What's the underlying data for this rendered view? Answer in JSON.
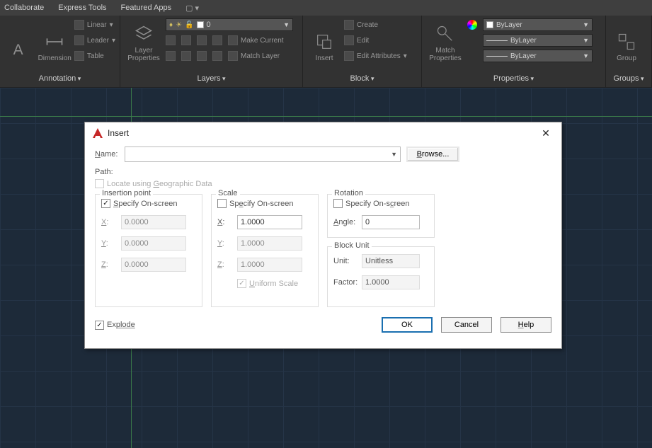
{
  "menu": {
    "collaborate": "Collaborate",
    "express": "Express Tools",
    "featured": "Featured Apps"
  },
  "ribbon": {
    "annotation": {
      "footer": "Annotation",
      "dimension": "Dimension",
      "linear": "Linear",
      "leader": "Leader",
      "table": "Table"
    },
    "layers": {
      "footer": "Layers",
      "properties": "Layer\nProperties",
      "current": "0",
      "make_current": "Make Current",
      "match": "Match Layer"
    },
    "block": {
      "footer": "Block",
      "insert": "Insert",
      "create": "Create",
      "edit": "Edit",
      "editattr": "Edit Attributes"
    },
    "properties": {
      "footer": "Properties",
      "match": "Match\nProperties",
      "color": "ByLayer",
      "ltype": "ByLayer",
      "lweight": "ByLayer"
    },
    "group": {
      "footer": "Groups",
      "group": "Group"
    }
  },
  "dialog": {
    "title": "Insert",
    "name_label": "Name:",
    "name_value": "",
    "browse": "Browse...",
    "path_label": "Path:",
    "locate_geo": "Locate using Geographic Data",
    "specify": "Specify On-screen",
    "insertion": {
      "title": "Insertion point",
      "x": "0.0000",
      "y": "0.0000",
      "z": "0.0000"
    },
    "scale": {
      "title": "Scale",
      "x": "1.0000",
      "y": "1.0000",
      "z": "1.0000",
      "uniform": "Uniform Scale"
    },
    "rotation": {
      "title": "Rotation",
      "angle_label": "Angle:",
      "angle": "0"
    },
    "unit": {
      "title": "Block Unit",
      "unit_label": "Unit:",
      "unit": "Unitless",
      "factor_label": "Factor:",
      "factor": "1.0000"
    },
    "explode": "Explode",
    "ok": "OK",
    "cancel": "Cancel",
    "help": "Help",
    "labels": {
      "X": "X:",
      "Y": "Y:",
      "Z": "Z:"
    }
  }
}
